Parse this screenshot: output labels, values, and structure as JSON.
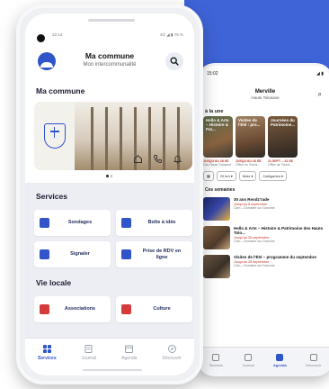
{
  "colors": {
    "accent": "#2f55c9",
    "background_blob": "#3f64d8"
  },
  "front": {
    "status": {
      "time": "22:14",
      "right": "4G ◢ ▮ 75 %"
    },
    "header": {
      "title": "Ma commune",
      "subtitle": "Mon intercommunalité"
    },
    "section_commune": "Ma commune",
    "banner_actions": [
      "home-icon",
      "phone-icon",
      "bell-icon"
    ],
    "section_services": "Services",
    "services": [
      {
        "label": "Sondages",
        "icon": "poll-icon",
        "color": "#2f55c9"
      },
      {
        "label": "Boîte à idée",
        "icon": "idea-icon",
        "color": "#2f55c9"
      },
      {
        "label": "Signaler",
        "icon": "report-icon",
        "color": "#2f55c9"
      },
      {
        "label": "Prise de RDV en ligne",
        "icon": "calendar-icon",
        "color": "#2f55c9"
      }
    ],
    "section_vie_locale": "Vie locale",
    "vie_locale": [
      {
        "label": "Associations",
        "icon": "associations-icon",
        "color": "#d63b3b"
      },
      {
        "label": "Culture",
        "icon": "culture-icon",
        "color": "#d63b3b"
      }
    ],
    "nav": [
      {
        "label": "Services",
        "icon": "grid-icon",
        "active": true
      },
      {
        "label": "Journal",
        "icon": "journal-icon",
        "active": false
      },
      {
        "label": "Agenda",
        "icon": "agenda-icon",
        "active": false
      },
      {
        "label": "Découvrir",
        "icon": "compass-icon",
        "active": false
      }
    ]
  },
  "back": {
    "status": {
      "time": "15:02",
      "right": "◢ ▮"
    },
    "header": {
      "title": "Merville",
      "subtitle": "Haute Tolosane"
    },
    "section_label": "à la une",
    "featured": [
      {
        "caption": "Hello & Arts – Histoire & Pat...",
        "date": "JUSQU'AU 28 SE",
        "org": "Cdc Hauts Tolosane"
      },
      {
        "caption": "Visites de l'Été : pro...",
        "date": "JUSQU'AU 28 SE",
        "org": "Office du Touris..."
      },
      {
        "caption": "Journées du Patrimoine...",
        "date": "21 SEPT. – 22 SE",
        "org": "Office de Touris..."
      }
    ],
    "filters": [
      "▦",
      "20 km ▾",
      "Mois ▾",
      "Catégories ▾"
    ],
    "list_label": "Ces semaines",
    "events": [
      {
        "title": "30 ans Rendz'rade",
        "date": "Jusqu'au 8 septembre",
        "org": "Cdm – Domaine sur Garonne"
      },
      {
        "title": "Hello & Arts – Histoire & Patrimoine des Hauts Tolo...",
        "date": "Jusqu'au 28 septembre",
        "org": "Cdm – Domaine sur Garonne"
      },
      {
        "title": "Visites de l'Été – programme du septembre",
        "date": "Jusqu'au 28 septembre",
        "org": "Cdm – Domaine sur Garonne"
      }
    ],
    "nav": [
      {
        "label": "Services",
        "active": false
      },
      {
        "label": "Journal",
        "active": false
      },
      {
        "label": "Agenda",
        "active": true
      },
      {
        "label": "Découvrir",
        "active": false
      }
    ]
  }
}
